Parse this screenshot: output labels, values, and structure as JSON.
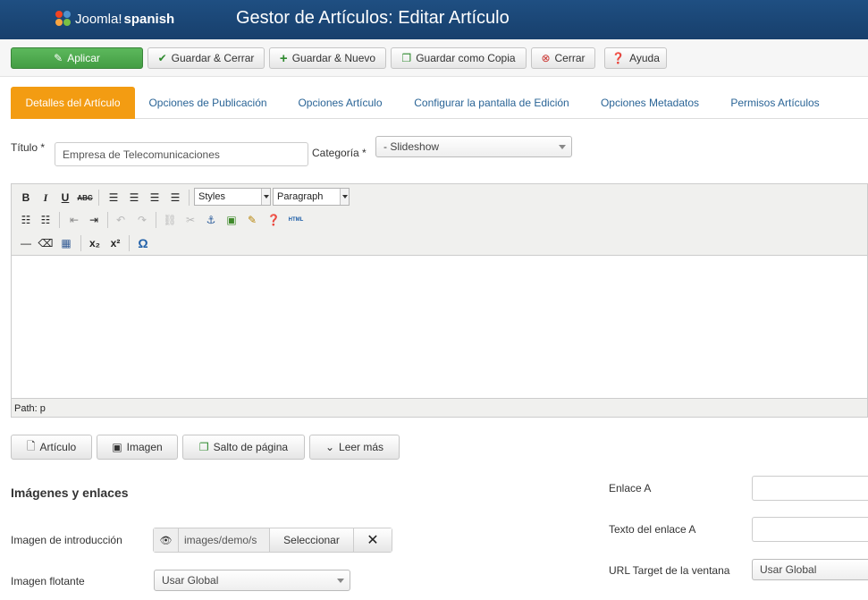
{
  "header": {
    "logo_word": "Joomla!",
    "logo_suffix": "spanish",
    "title": "Gestor de Artículos: Editar Artículo"
  },
  "toolbar": {
    "apply": "Aplicar",
    "save_close": "Guardar & Cerrar",
    "save_new": "Guardar & Nuevo",
    "save_copy": "Guardar como Copia",
    "close": "Cerrar",
    "help": "Ayuda"
  },
  "tabs": [
    {
      "label": "Detalles del Artículo",
      "active": true
    },
    {
      "label": "Opciones de Publicación"
    },
    {
      "label": "Opciones Artículo"
    },
    {
      "label": "Configurar la pantalla de Edición"
    },
    {
      "label": "Opciones Metadatos"
    },
    {
      "label": "Permisos Artículos"
    }
  ],
  "form": {
    "title_label": "Título",
    "title_value": "Empresa de Telecomunicaciones",
    "category_label": "Categoría",
    "category_value": "- Slideshow",
    "required_mark": "*"
  },
  "editor": {
    "styles_label": "Styles",
    "format_label": "Paragraph",
    "path_text": "Path: p",
    "html_label": "HTML"
  },
  "editor_buttons": {
    "article": "Artículo",
    "image": "Imagen",
    "pagebreak": "Salto de página",
    "readmore": "Leer más"
  },
  "images_links": {
    "section_title": "Imágenes y enlaces",
    "intro_image_label": "Imagen de introducción",
    "intro_image_value": "images/demo/s",
    "select_label": "Seleccionar",
    "float_image_label": "Imagen flotante",
    "float_image_value": "Usar Global",
    "link_a_label": "Enlace A",
    "link_a_text_label": "Texto del enlace A",
    "url_target_label": "URL Target de la ventana",
    "url_target_value": "Usar Global"
  }
}
